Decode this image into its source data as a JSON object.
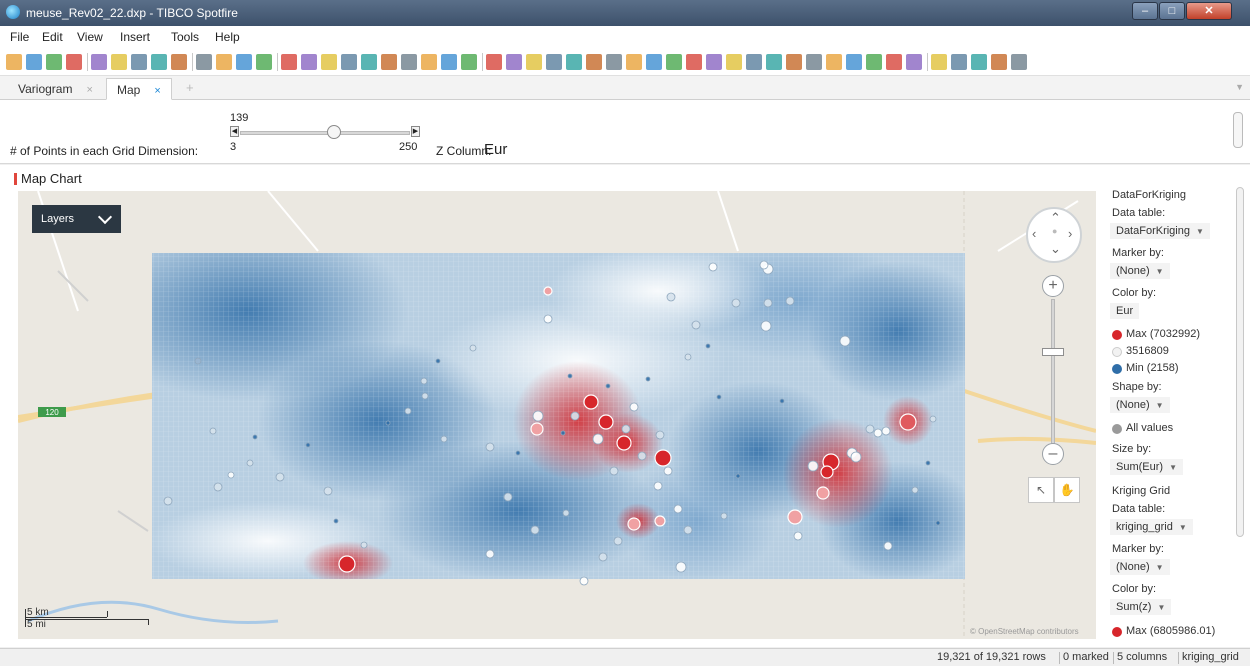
{
  "window": {
    "title": "meuse_Rev02_22.dxp - TIBCO Spotfire"
  },
  "menu": [
    "File",
    "Edit",
    "View",
    "Insert",
    "Tools",
    "Help"
  ],
  "tabs": [
    {
      "label": "Variogram"
    },
    {
      "label": "Map"
    }
  ],
  "controls": {
    "grid_label": "# of Points in each Grid Dimension:",
    "slider_value": "139",
    "slider_min": "3",
    "slider_max": "250",
    "slider_fraction": 0.55,
    "z_label": "Z Column:",
    "z_value": "Eur"
  },
  "visualization": {
    "title": "Map Chart",
    "layers_label": "Layers",
    "road_shield": "120",
    "attribution": "© OpenStreetMap contributors",
    "scale_km": "5 km",
    "scale_mi": "5 mi"
  },
  "legend": {
    "layer1_name": "DataForKriging",
    "data_table_label": "Data table:",
    "layer1_table": "DataForKriging",
    "marker_by_label": "Marker by:",
    "none": "(None)",
    "color_by_label": "Color by:",
    "layer1_color": "Eur",
    "max1": "Max (7032992)",
    "mid1": "3516809",
    "min1": "Min (2158)",
    "shape_by_label": "Shape by:",
    "all_values": "All values",
    "size_by_label": "Size by:",
    "size_value": "Sum(Eur)",
    "layer2_name": "Kriging Grid",
    "layer2_table": "kriging_grid",
    "layer2_color": "Sum(z)",
    "max2": "Max (6805986.01)"
  },
  "status": {
    "rows": "19,321 of 19,321 rows",
    "marked": "0 marked",
    "columns": "5 columns",
    "table": "kriging_grid"
  },
  "colors": {
    "max": "#d7262b",
    "mid": "#f2f2f2",
    "min": "#2f6ea8",
    "all_values": "#9a9a9a",
    "accent": "#1b87d6"
  }
}
